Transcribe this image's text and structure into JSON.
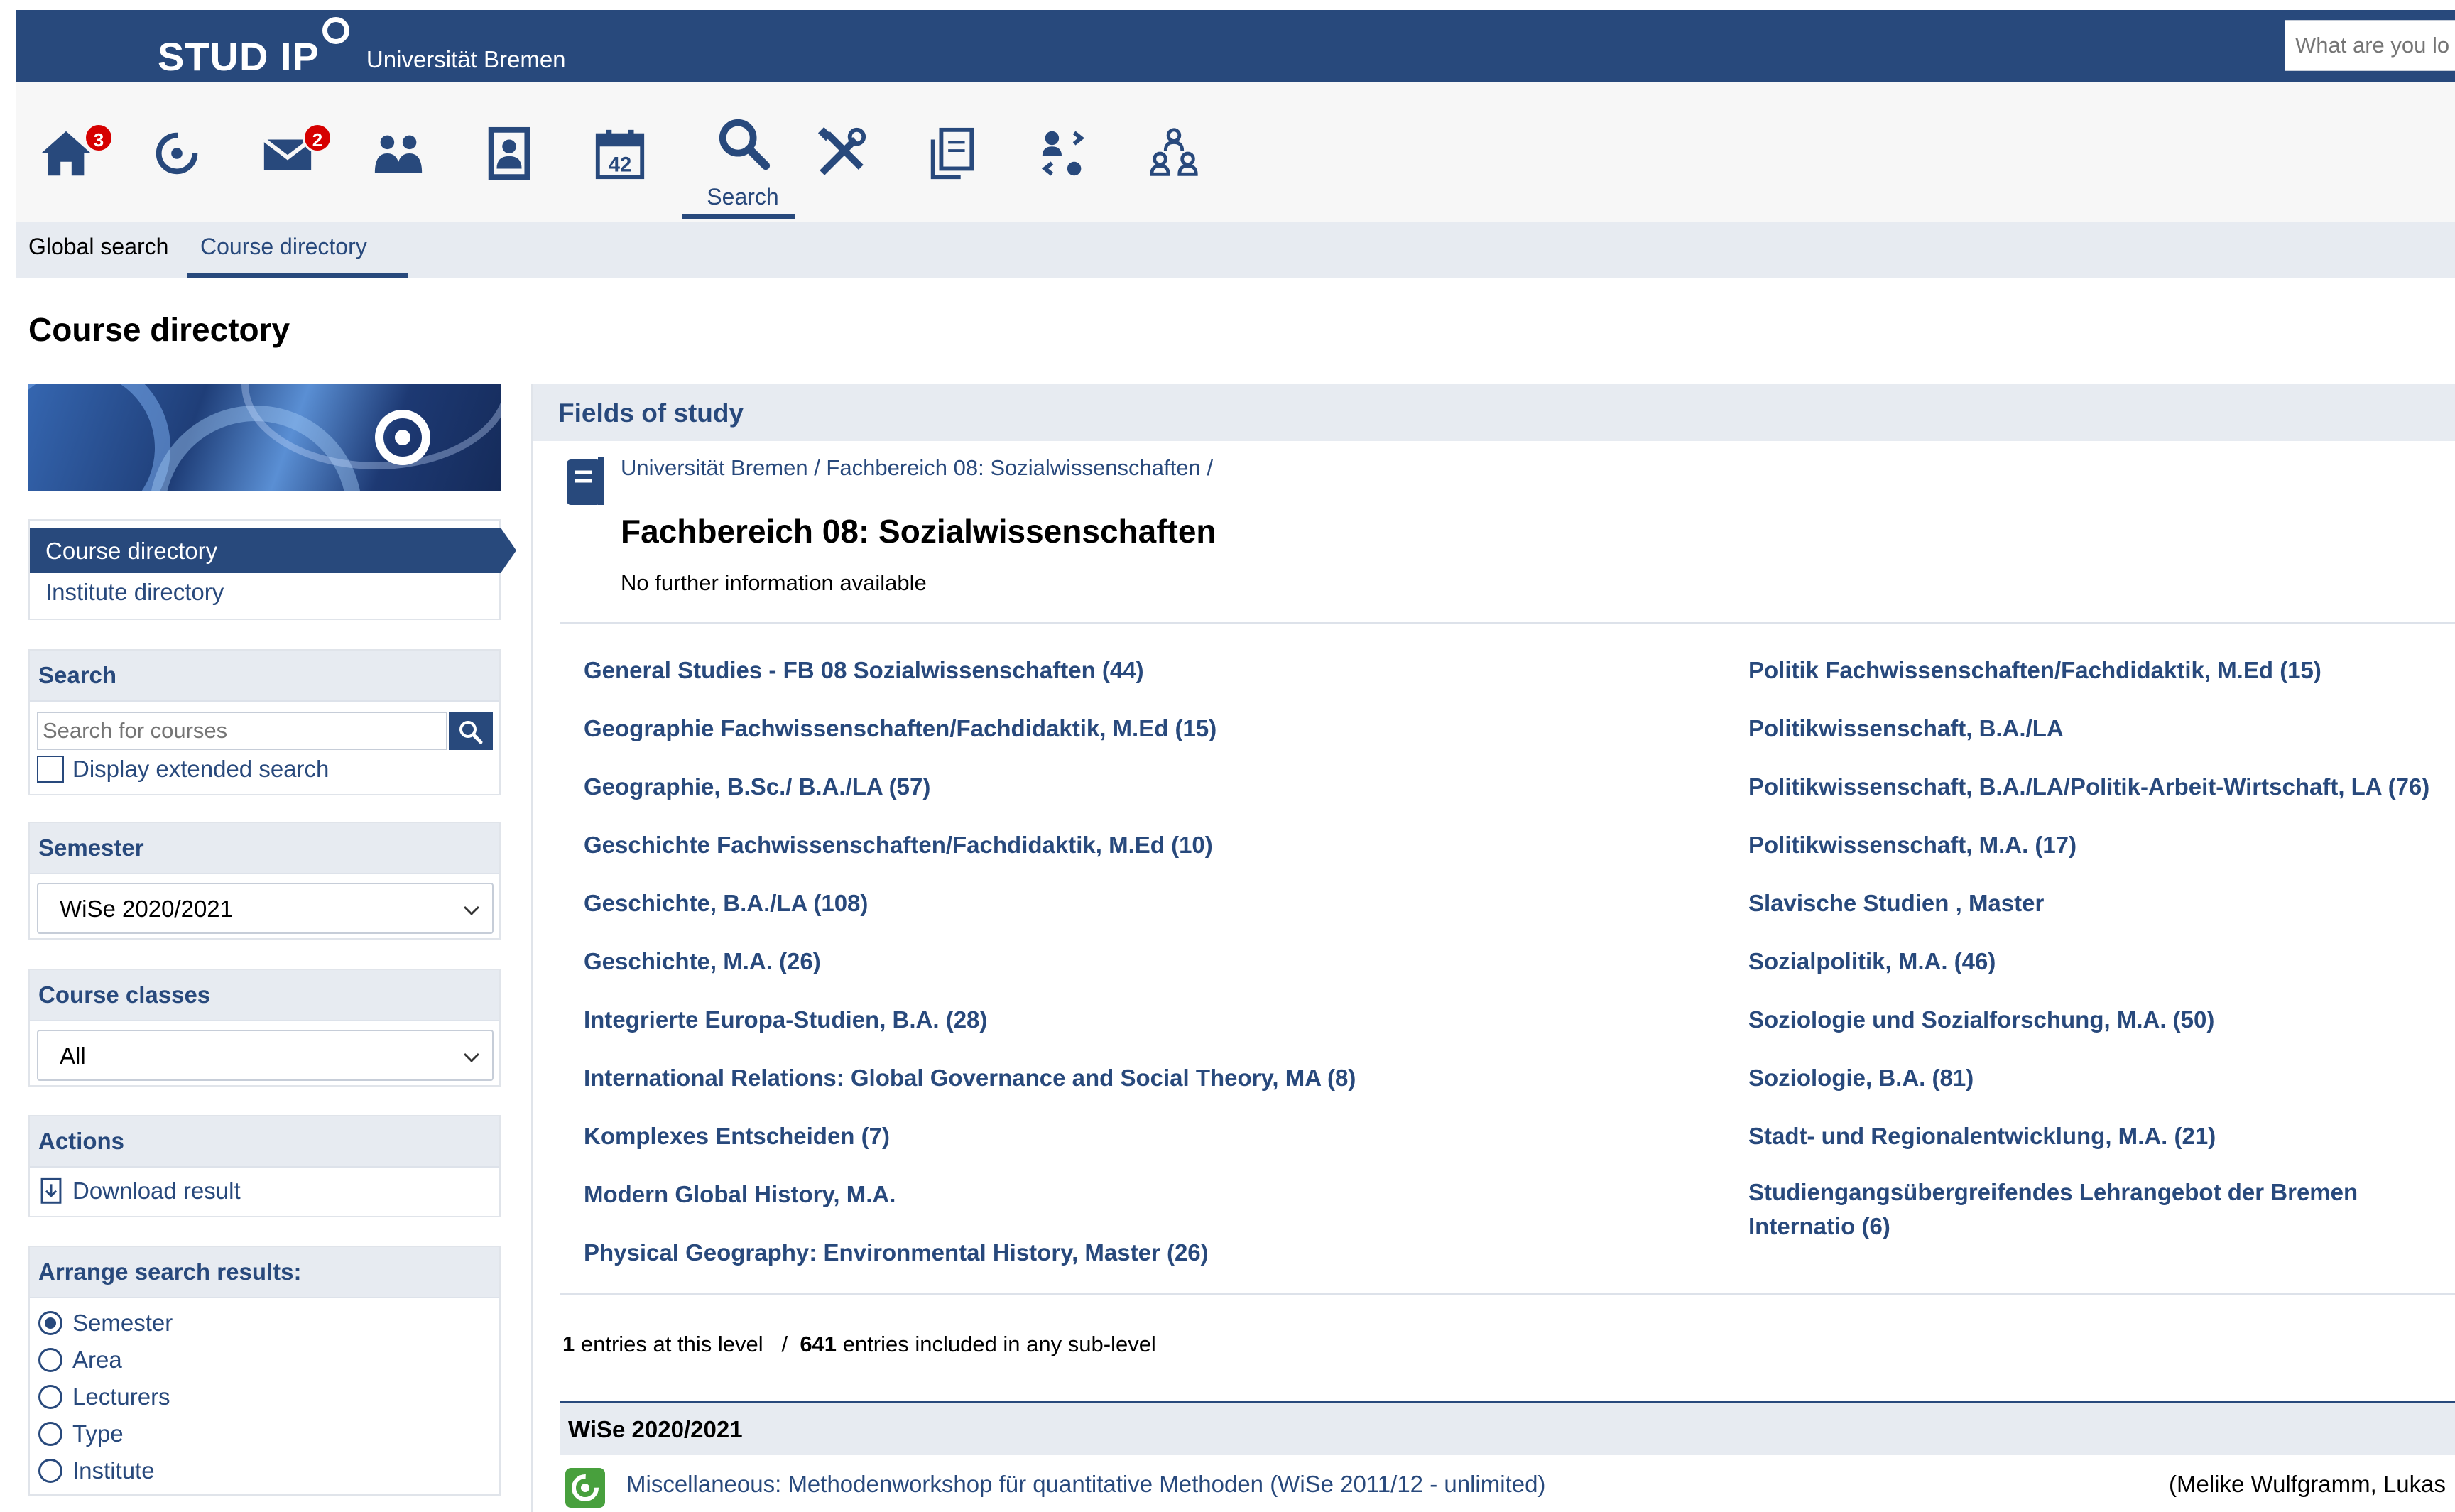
{
  "header": {
    "brand": "STUD IP",
    "university": "Universität Bremen",
    "quicksearch_placeholder": "What are you lo"
  },
  "nav": {
    "search_label": "Search",
    "badges": {
      "home": "3",
      "messages": "2"
    },
    "icons": [
      "home-icon",
      "studip-icon",
      "messages-icon",
      "community-icon",
      "profile-icon",
      "calendar-icon",
      "search-icon",
      "tools-icon",
      "files-icon",
      "contacts-icon",
      "admin-icon"
    ],
    "calendar_day": "42"
  },
  "tabs": {
    "global": "Global search",
    "course": "Course directory"
  },
  "page_title": "Course directory",
  "sidebar": {
    "nav_course_dir": "Course directory",
    "nav_inst_dir": "Institute directory",
    "search_head": "Search",
    "search_placeholder": "Search for courses",
    "ext_search": "Display extended search",
    "semester_head": "Semester",
    "semester_value": "WiSe 2020/2021",
    "course_classes_head": "Course classes",
    "course_classes_value": "All",
    "actions_head": "Actions",
    "download": "Download result",
    "arrange_head": "Arrange search results:",
    "arrange_options": [
      "Semester",
      "Area",
      "Lecturers",
      "Type",
      "Institute"
    ],
    "arrange_selected": "Semester"
  },
  "main": {
    "fields_head": "Fields of study",
    "breadcrumb": "Universität Bremen / Fachbereich 08: Sozialwissenschaften /",
    "faculty_title": "Fachbereich 08: Sozialwissenschaften",
    "no_info": "No further information available",
    "left_fields": [
      "General Studies - FB 08 Sozialwissenschaften (44)",
      "Geographie Fachwissenschaften/Fachdidaktik, M.Ed (15)",
      "Geographie, B.Sc./ B.A./LA (57)",
      "Geschichte Fachwissenschaften/Fachdidaktik, M.Ed (10)",
      "Geschichte, B.A./LA (108)",
      "Geschichte, M.A. (26)",
      "Integrierte Europa-Studien, B.A. (28)",
      "International Relations: Global Governance and Social Theory, MA (8)",
      "Komplexes Entscheiden (7)",
      "Modern Global History, M.A.",
      "Physical Geography: Environmental History, Master (26)"
    ],
    "right_fields": [
      "Politik Fachwissenschaften/Fachdidaktik, M.Ed (15)",
      "Politikwissenschaft, B.A./LA",
      "Politikwissenschaft, B.A./LA/Politik-Arbeit-Wirtschaft, LA (76)",
      "Politikwissenschaft, M.A. (17)",
      "Slavische Studien , Master",
      "Sozialpolitik, M.A. (46)",
      "Soziologie und Sozialforschung, M.A. (50)",
      "Soziologie, B.A. (81)",
      "Stadt- und Regionalentwicklung, M.A. (21)",
      "Studiengangsübergreifendes Lehrangebot der Bremen Internatio (6)"
    ],
    "entries": {
      "level_count": "1",
      "level_text": "entries at this level",
      "sep": "/",
      "sub_count": "641",
      "sub_text": "entries included in any sub-level"
    },
    "semester_group": "WiSe 2020/2021",
    "course": {
      "title": "Miscellaneous: Methodenworkshop für quantitative Methoden (WiSe 2011/12 - unlimited)",
      "lecturers": "(Melike Wulfgramm, Lukas"
    }
  },
  "colors": {
    "primary": "#28497c",
    "panel": "#e7ebf1",
    "badge": "#d60000",
    "course_icon": "#48a03d"
  }
}
